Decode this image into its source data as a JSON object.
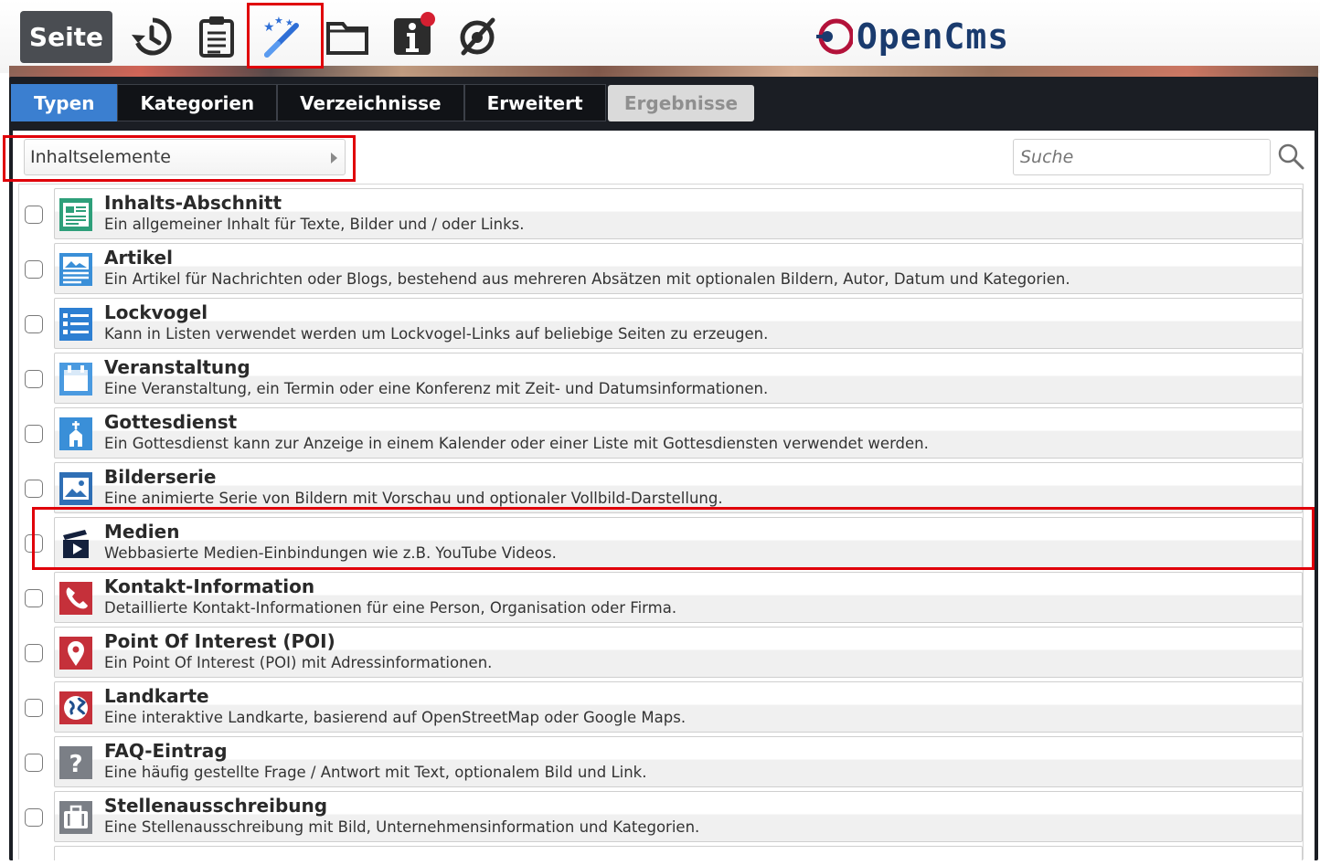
{
  "toolbar": {
    "seite_label": "Seite",
    "icons": [
      "history-icon",
      "clipboard-icon",
      "magic-wand-icon",
      "folder-icon",
      "info-icon",
      "eye-slash-icon"
    ]
  },
  "logo": {
    "text": "OpenCms"
  },
  "tabs": [
    {
      "label": "Typen",
      "active": true
    },
    {
      "label": "Kategorien",
      "active": false
    },
    {
      "label": "Verzeichnisse",
      "active": false
    },
    {
      "label": "Erweitert",
      "active": false
    }
  ],
  "results_button": {
    "label": "Ergebnisse"
  },
  "type_select": {
    "value": "Inhaltselemente"
  },
  "search": {
    "placeholder": "Suche"
  },
  "types": [
    {
      "title": "Inhalts-Abschnitt",
      "desc": "Ein allgemeiner Inhalt für Texte, Bilder und / oder Links.",
      "icon": "section-icon"
    },
    {
      "title": "Artikel",
      "desc": "Ein Artikel für Nachrichten oder Blogs, bestehend aus mehreren Absätzen mit optionalen Bildern, Autor, Datum und Kategorien.",
      "icon": "article-icon"
    },
    {
      "title": "Lockvogel",
      "desc": "Kann in Listen verwendet werden um Lockvogel-Links auf beliebige Seiten zu erzeugen.",
      "icon": "list-icon"
    },
    {
      "title": "Veranstaltung",
      "desc": "Eine Veranstaltung, ein Termin oder eine Konferenz mit Zeit- und Datumsinformationen.",
      "icon": "calendar-icon"
    },
    {
      "title": "Gottesdienst",
      "desc": "Ein Gottesdienst kann zur Anzeige in einem Kalender oder einer Liste mit Gottesdiensten verwendet werden.",
      "icon": "church-icon"
    },
    {
      "title": "Bilderserie",
      "desc": "Eine animierte Serie von Bildern mit Vorschau und optionaler Vollbild-Darstellung.",
      "icon": "image-icon"
    },
    {
      "title": "Medien",
      "desc": "Webbasierte Medien-Einbindungen wie z.B. YouTube Videos.",
      "icon": "media-icon"
    },
    {
      "title": "Kontakt-Information",
      "desc": "Detaillierte Kontakt-Informationen für eine Person, Organisation oder Firma.",
      "icon": "phone-icon"
    },
    {
      "title": "Point Of Interest (POI)",
      "desc": "Ein Point Of Interest (POI) mit Adressinformationen.",
      "icon": "map-marker-icon"
    },
    {
      "title": "Landkarte",
      "desc": "Eine interaktive Landkarte, basierend auf OpenStreetMap oder Google Maps.",
      "icon": "globe-icon"
    },
    {
      "title": "FAQ-Eintrag",
      "desc": "Eine häufig gestellte Frage / Antwort mit Text, optionalem Bild und Link.",
      "icon": "question-icon"
    },
    {
      "title": "Stellenausschreibung",
      "desc": "Eine Stellenausschreibung mit Bild, Unternehmensinformation und Kategorien.",
      "icon": "briefcase-icon"
    }
  ],
  "colors": {
    "active_tab": "#3b7fd0",
    "highlight": "#e0000a",
    "dialog_bg": "#1b1e24"
  }
}
